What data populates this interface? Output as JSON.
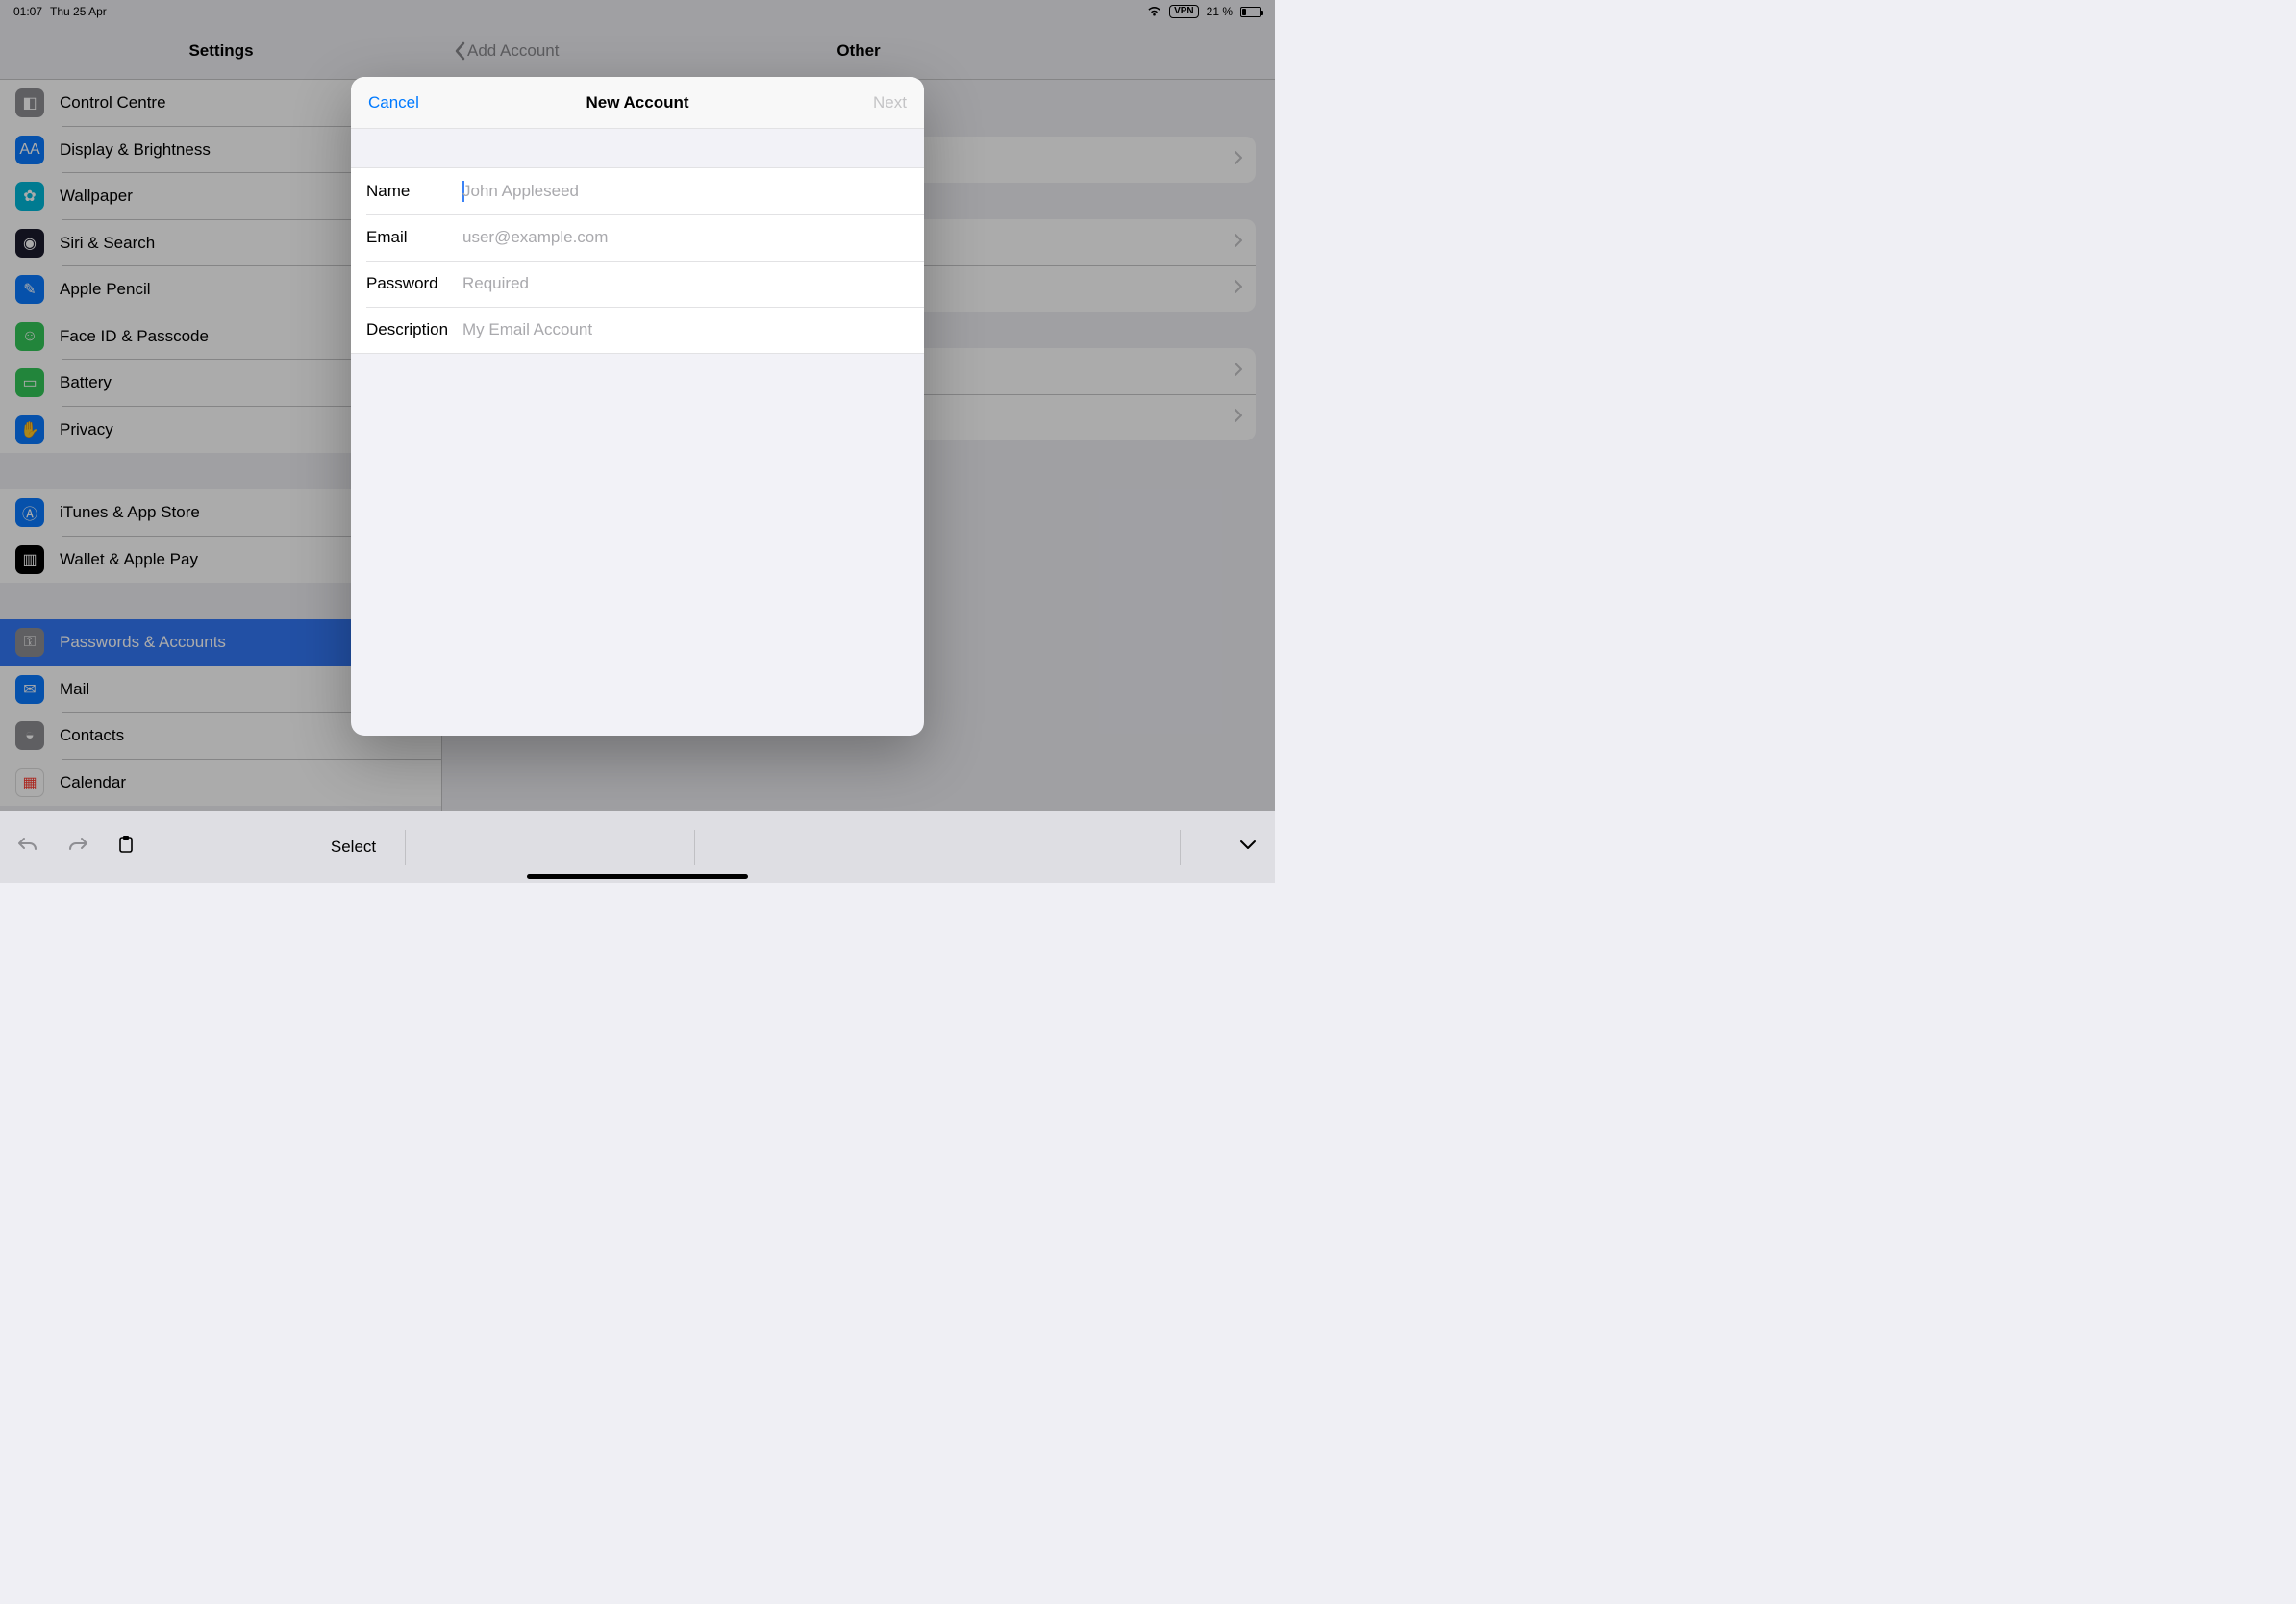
{
  "status": {
    "time": "01:07",
    "date": "Thu 25 Apr",
    "vpn_label": "VPN",
    "battery_pct": "21 %"
  },
  "nav": {
    "sidebar_title": "Settings",
    "back_label": "Add Account",
    "detail_title": "Other"
  },
  "sidebar": {
    "groups": [
      {
        "rows": [
          {
            "label": "Control Centre",
            "icon": "control-centre",
            "bg": "#8e8e93"
          },
          {
            "label": "Display & Brightness",
            "icon": "display",
            "bg": "#0a7aff"
          },
          {
            "label": "Wallpaper",
            "icon": "wallpaper",
            "bg": "#00b8d9"
          },
          {
            "label": "Siri & Search",
            "icon": "siri",
            "bg": "#1b1b2e"
          },
          {
            "label": "Apple Pencil",
            "icon": "pencil",
            "bg": "#0a7aff"
          },
          {
            "label": "Face ID & Passcode",
            "icon": "faceid",
            "bg": "#34c759"
          },
          {
            "label": "Battery",
            "icon": "battery",
            "bg": "#34c759"
          },
          {
            "label": "Privacy",
            "icon": "privacy",
            "bg": "#0a7aff"
          }
        ]
      },
      {
        "rows": [
          {
            "label": "iTunes & App Store",
            "icon": "appstore",
            "bg": "#0a7aff"
          },
          {
            "label": "Wallet & Apple Pay",
            "icon": "wallet",
            "bg": "#000000"
          }
        ]
      },
      {
        "rows": [
          {
            "label": "Passwords & Accounts",
            "icon": "key",
            "bg": "#8e8e93",
            "selected": true
          },
          {
            "label": "Mail",
            "icon": "mail",
            "bg": "#0a7aff"
          },
          {
            "label": "Contacts",
            "icon": "contacts",
            "bg": "#8e8e93"
          },
          {
            "label": "Calendar",
            "icon": "calendar",
            "bg": "#ffffff"
          }
        ]
      }
    ]
  },
  "modal": {
    "cancel": "Cancel",
    "title": "New Account",
    "next": "Next",
    "fields": {
      "name": {
        "label": "Name",
        "placeholder": "John Appleseed",
        "value": ""
      },
      "email": {
        "label": "Email",
        "placeholder": "user@example.com",
        "value": ""
      },
      "password": {
        "label": "Password",
        "placeholder": "Required",
        "value": ""
      },
      "description": {
        "label": "Description",
        "placeholder": "My Email Account",
        "value": ""
      }
    }
  },
  "shortcut_bar": {
    "select": "Select"
  }
}
